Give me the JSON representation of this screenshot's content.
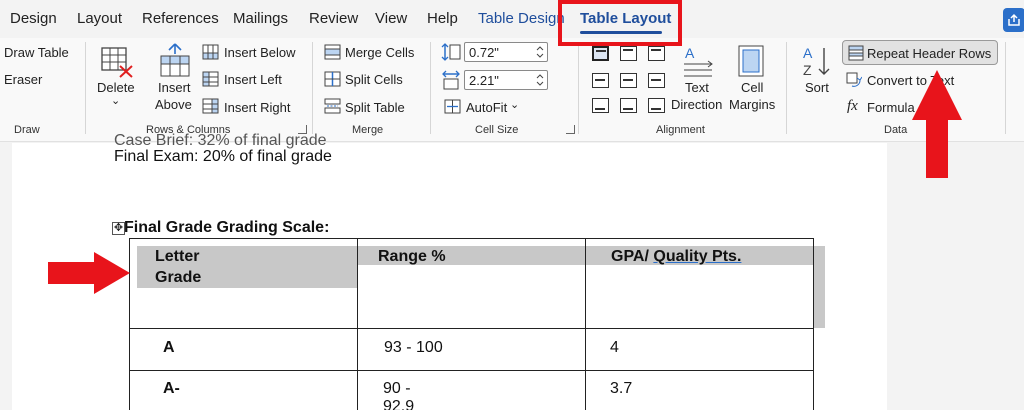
{
  "tabs": [
    "Design",
    "Layout",
    "References",
    "Mailings",
    "Review",
    "View",
    "Help",
    "Table Design",
    "Table Layout"
  ],
  "ribbon": {
    "draw": {
      "draw_table": "Draw Table",
      "eraser": "Eraser",
      "label": "Draw"
    },
    "rows_columns": {
      "delete": "Delete",
      "insert_above_1": "Insert",
      "insert_above_2": "Above",
      "insert_below": "Insert Below",
      "insert_left": "Insert Left",
      "insert_right": "Insert Right",
      "label": "Rows & Columns"
    },
    "merge": {
      "merge_cells": "Merge Cells",
      "split_cells": "Split Cells",
      "split_table": "Split Table",
      "label": "Merge"
    },
    "cell_size": {
      "height": "0.72\"",
      "width": "2.21\"",
      "autofit": "AutoFit",
      "label": "Cell Size"
    },
    "alignment": {
      "text_direction_1": "Text",
      "text_direction_2": "Direction",
      "cell_margins_1": "Cell",
      "cell_margins_2": "Margins",
      "label": "Alignment"
    },
    "data": {
      "sort": "Sort",
      "repeat_header_rows": "Repeat Header Rows",
      "convert_to_text": "Convert to Text",
      "formula": "Formula",
      "label": "Data"
    }
  },
  "document": {
    "line_partial": "Case Brief: 32% of final grade",
    "line_final_exam": "Final Exam: 20% of final grade",
    "heading": "Final Grade Grading Scale:",
    "table": {
      "header": [
        "Letter",
        "Grade",
        "Range %",
        "GPA/ ",
        "Quality  Pts."
      ],
      "rows": [
        [
          "A",
          "93 - 100",
          "4"
        ],
        [
          "A-",
          "90 -",
          "92.9",
          "3.7"
        ]
      ]
    }
  },
  "colors": {
    "accent": "#1f4e9c",
    "annotation_red": "#e8141b"
  }
}
